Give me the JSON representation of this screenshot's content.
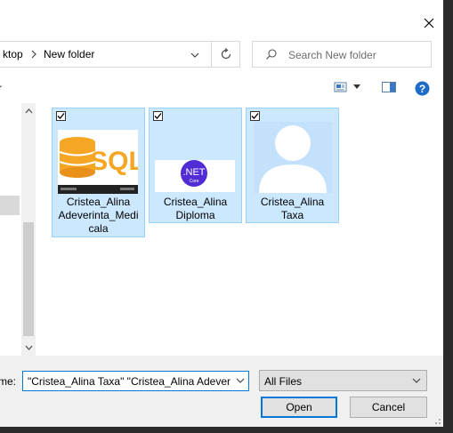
{
  "window": {
    "close_icon": "close-icon"
  },
  "address": {
    "crumbs": [
      "ktop",
      "New folder"
    ],
    "separator": ">"
  },
  "search": {
    "placeholder": "Search New folder"
  },
  "toolbar": {
    "left_text": "r",
    "view_icon": "view-options-icon",
    "pane_icon": "preview-pane-icon",
    "help_icon": "help-icon"
  },
  "files": [
    {
      "name": "Cristea_Alina Adeverinta_Medi cala",
      "line1": "Cristea_Alina",
      "line2": "Adeverinta_Medi",
      "line3": "cala",
      "thumb": "sql-thumbnail",
      "checked": true
    },
    {
      "name": "Cristea_Alina Diploma",
      "line1": "Cristea_Alina",
      "line2": "Diploma",
      "thumb": "dotnet-thumbnail",
      "checked": true
    },
    {
      "name": "Cristea_Alina Taxa",
      "line1": "Cristea_Alina",
      "line2": "Taxa",
      "thumb": "person-placeholder-thumbnail",
      "checked": true
    }
  ],
  "thumbs": {
    "sql_text": "SQL",
    "dotnet_text": ".NET",
    "dotnet_sub": "Core"
  },
  "bottom": {
    "filename_label": "me:",
    "filename_value": "\"Cristea_Alina Taxa\" \"Cristea_Alina Adeverinta_Medicala\"",
    "filter_value": "All Files",
    "open_label": "Open",
    "cancel_label": "Cancel"
  },
  "colors": {
    "selection_bg": "#cce8ff",
    "selection_border": "#99d1ff",
    "accent": "#0078d7"
  }
}
